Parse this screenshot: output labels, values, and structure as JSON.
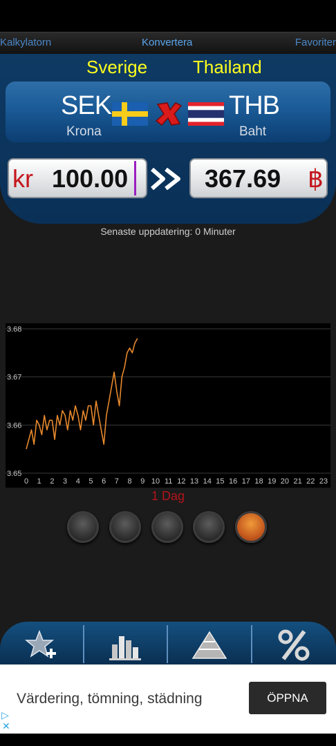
{
  "tabs": {
    "calculator": "Kalkylatorn",
    "convert": "Konvertera",
    "favorites": "Favoriter"
  },
  "from": {
    "country": "Sverige",
    "code": "SEK",
    "name": "Krona",
    "symbol": "kr",
    "amount": "100.00",
    "flag_icon": "sweden-flag-icon"
  },
  "to": {
    "country": "Thailand",
    "code": "THB",
    "name": "Baht",
    "symbol": "฿",
    "amount": "367.69",
    "flag_icon": "thailand-flag-icon"
  },
  "update_text": "Senaste uppdatering: 0 Minuter",
  "chart_period": "1 Dag",
  "chart_data": {
    "type": "line",
    "title": "",
    "xlabel": "",
    "ylabel": "",
    "xlim": [
      0,
      23
    ],
    "ylim": [
      3.65,
      3.68
    ],
    "x_ticks": [
      0,
      1,
      2,
      3,
      4,
      5,
      6,
      7,
      8,
      9,
      10,
      11,
      12,
      13,
      14,
      15,
      16,
      17,
      18,
      19,
      20,
      21,
      22,
      23
    ],
    "y_ticks": [
      3.65,
      3.66,
      3.67,
      3.68
    ],
    "grid": "horizontal",
    "series": [
      {
        "color": "#e8892c",
        "x": [
          0,
          0.2,
          0.4,
          0.6,
          0.8,
          1,
          1.2,
          1.4,
          1.6,
          1.8,
          2,
          2.2,
          2.4,
          2.6,
          2.8,
          3,
          3.2,
          3.4,
          3.6,
          3.8,
          4,
          4.2,
          4.4,
          4.6,
          4.8,
          5,
          5.2,
          5.4,
          5.6,
          5.8,
          6,
          6.2,
          6.4,
          6.6,
          6.8,
          7,
          7.2,
          7.4,
          7.6,
          7.8,
          8,
          8.2,
          8.4,
          8.6
        ],
        "y": [
          3.655,
          3.657,
          3.659,
          3.656,
          3.661,
          3.66,
          3.658,
          3.662,
          3.659,
          3.661,
          3.661,
          3.657,
          3.662,
          3.66,
          3.663,
          3.662,
          3.659,
          3.663,
          3.661,
          3.664,
          3.662,
          3.659,
          3.663,
          3.661,
          3.664,
          3.664,
          3.66,
          3.665,
          3.662,
          3.659,
          3.656,
          3.662,
          3.665,
          3.668,
          3.671,
          3.667,
          3.664,
          3.67,
          3.672,
          3.675,
          3.676,
          3.675,
          3.677,
          3.678
        ]
      }
    ]
  },
  "period_buttons": [
    "period-1",
    "period-2",
    "period-3",
    "period-4",
    "period-5"
  ],
  "active_period_index": 4,
  "toolbar": {
    "add_favorite_icon": "star-plus-icon",
    "chart_icon": "bar-chart-icon",
    "pyramid_icon": "pyramid-icon",
    "percent_icon": "percent-icon"
  },
  "ad": {
    "text": "Värdering, tömning, städning",
    "button": "ÖPPNA"
  },
  "colors": {
    "accent_yellow": "#ffff1e",
    "panel_blue": "#0e3a63",
    "symbol_red": "#c4161c",
    "line_orange": "#e8892c"
  }
}
